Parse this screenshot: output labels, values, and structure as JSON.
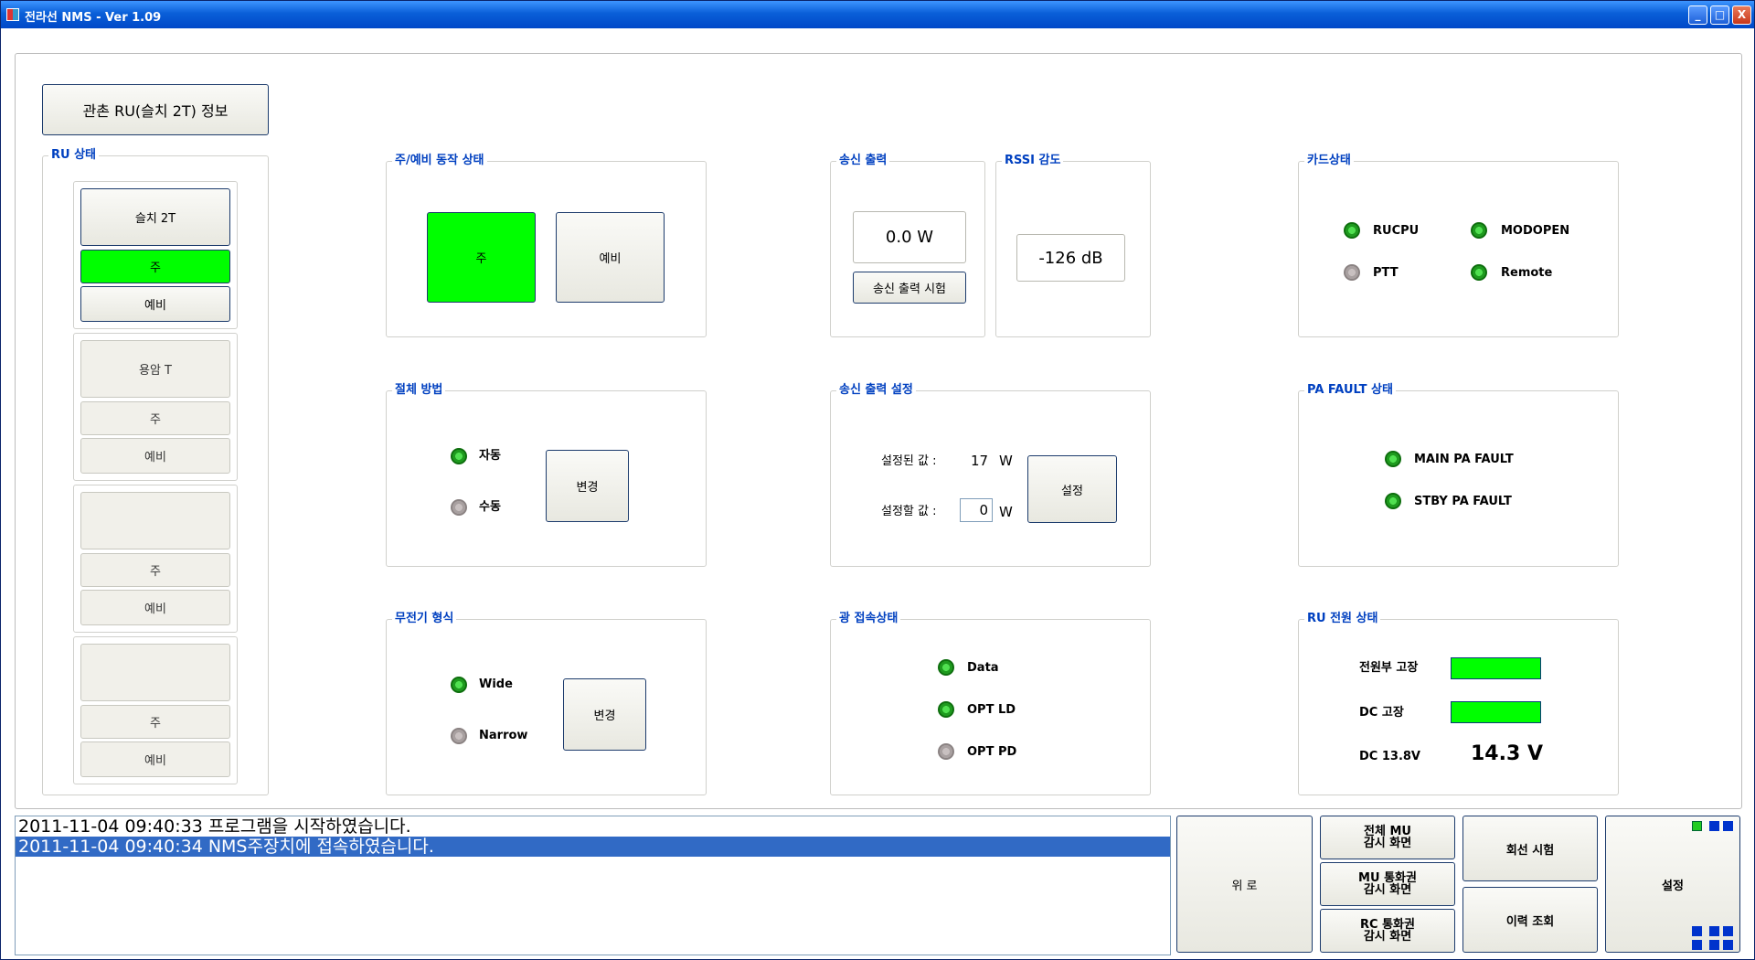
{
  "window": {
    "title": "전라선 NMS  - Ver 1.09",
    "minimize": "_",
    "maximize": "□",
    "close": "X"
  },
  "info_button": "관촌 RU(슬치 2T) 정보",
  "ru_status": {
    "label": "RU 상태",
    "units": [
      {
        "name": "슬치 2T",
        "main": "주",
        "standby": "예비"
      },
      {
        "name": "용암 T",
        "main": "주",
        "standby": "예비"
      },
      {
        "name": "",
        "main": "주",
        "standby": "예비"
      },
      {
        "name": "",
        "main": "주",
        "standby": "예비"
      }
    ]
  },
  "operation": {
    "label": "주/예비 동작 상태",
    "main": "주",
    "standby": "예비"
  },
  "tx_output": {
    "label": "송신 출력",
    "value": "0.0  W",
    "test_button": "송신 출력 시험"
  },
  "rssi": {
    "label": "RSSI 감도",
    "value": "-126 dB"
  },
  "card_status": {
    "label": "카드상태",
    "items": [
      {
        "name": "RUCPU",
        "on": true
      },
      {
        "name": "MODOPEN",
        "on": true
      },
      {
        "name": "PTT",
        "on": false
      },
      {
        "name": "Remote",
        "on": true
      }
    ]
  },
  "switch_method": {
    "label": "절체 방법",
    "auto": "자동",
    "manual": "수동",
    "change": "변경",
    "auto_on": true
  },
  "tx_setting": {
    "label": "송신 출력 설정",
    "set_label": "설정된 값 :",
    "set_value": "17",
    "unit": "W",
    "new_label": "설정할 값 :",
    "new_value": "0",
    "button": "설정"
  },
  "pa_fault": {
    "label": "PA FAULT 상태",
    "main": "MAIN PA FAULT",
    "stby": "STBY PA FAULT"
  },
  "radio_type": {
    "label": "무전기 형식",
    "wide": "Wide",
    "narrow": "Narrow",
    "change": "변경",
    "wide_on": true
  },
  "optical": {
    "label": "광 접속상태",
    "items": [
      {
        "name": "Data",
        "on": true
      },
      {
        "name": "OPT LD",
        "on": true
      },
      {
        "name": "OPT PD",
        "on": false
      }
    ]
  },
  "ru_power": {
    "label": "RU 전원 상태",
    "psu_fault": "전원부 고장",
    "dc_fault": "DC 고장",
    "dc_label": "DC 13.8V",
    "dc_value": "14.3 V"
  },
  "log": {
    "lines": [
      "2011-11-04 09:40:33 프로그램을 시작하였습니다.",
      "2011-11-04 09:40:34 NMS주장치에 접속하였습니다."
    ]
  },
  "bottom": {
    "up": "위 로",
    "all_mu": "전체 MU\n감시 화면",
    "mu_call": "MU 통화권\n감시 화면",
    "rc_call": "RC 통화권\n감시 화면",
    "line_test": "회선 시험",
    "history": "이력 조회",
    "settings": "설정"
  },
  "colors": {
    "active_green": "#00ff00",
    "label_blue": "#0040c0",
    "selection": "#316ac5"
  }
}
